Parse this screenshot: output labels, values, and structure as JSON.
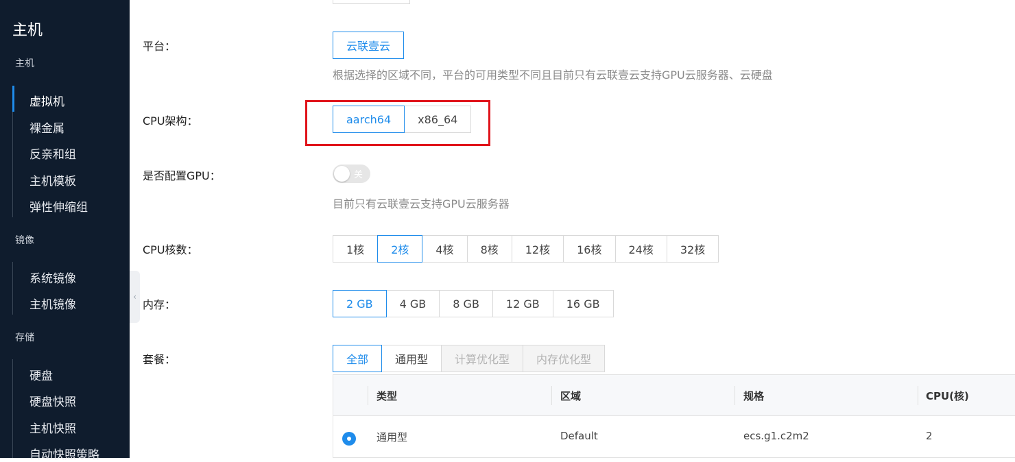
{
  "sidebar": {
    "title": "主机",
    "groups": [
      {
        "label": "主机",
        "items": [
          "虚拟机",
          "裸金属",
          "反亲和组",
          "主机模板",
          "弹性伸缩组"
        ]
      },
      {
        "label": "镜像",
        "items": [
          "系统镜像",
          "主机镜像"
        ]
      },
      {
        "label": "存储",
        "items": [
          "硬盘",
          "硬盘快照",
          "主机快照",
          "自动快照策略"
        ]
      }
    ],
    "active_item": "虚拟机",
    "collapse_icon": "chevron-left-icon"
  },
  "form": {
    "platform": {
      "label": "平台：",
      "options": [
        "云联壹云"
      ],
      "selected": "云联壹云",
      "hint": "根据选择的区域不同，平台的可用类型不同且目前只有云联壹云支持GPU云服务器、云硬盘"
    },
    "cpu_arch": {
      "label": "CPU架构：",
      "options": [
        "aarch64",
        "x86_64"
      ],
      "selected": "aarch64"
    },
    "gpu": {
      "label": "是否配置GPU：",
      "toggle_text": "关",
      "enabled": false,
      "hint": "目前只有云联壹云支持GPU云服务器"
    },
    "cpu_cores": {
      "label": "CPU核数：",
      "options": [
        "1核",
        "2核",
        "4核",
        "8核",
        "12核",
        "16核",
        "24核",
        "32核"
      ],
      "selected": "2核"
    },
    "memory": {
      "label": "内存：",
      "options": [
        "2 GB",
        "4 GB",
        "8 GB",
        "12 GB",
        "16 GB"
      ],
      "selected": "2 GB"
    },
    "package": {
      "label": "套餐：",
      "options": [
        "全部",
        "通用型",
        "计算优化型",
        "内存优化型"
      ],
      "selected": "全部",
      "disabled": [
        "计算优化型",
        "内存优化型"
      ]
    }
  },
  "table": {
    "columns": [
      "类型",
      "区域",
      "规格",
      "CPU(核)"
    ],
    "rows": [
      {
        "type": "通用型",
        "region": "Default",
        "spec": "ecs.g1.c2m2",
        "cpu": "2",
        "selected": true
      }
    ]
  },
  "colors": {
    "accent": "#1f8ceb",
    "sidebar_bg": "#0f1c2d",
    "highlight_box": "#e0141b"
  }
}
